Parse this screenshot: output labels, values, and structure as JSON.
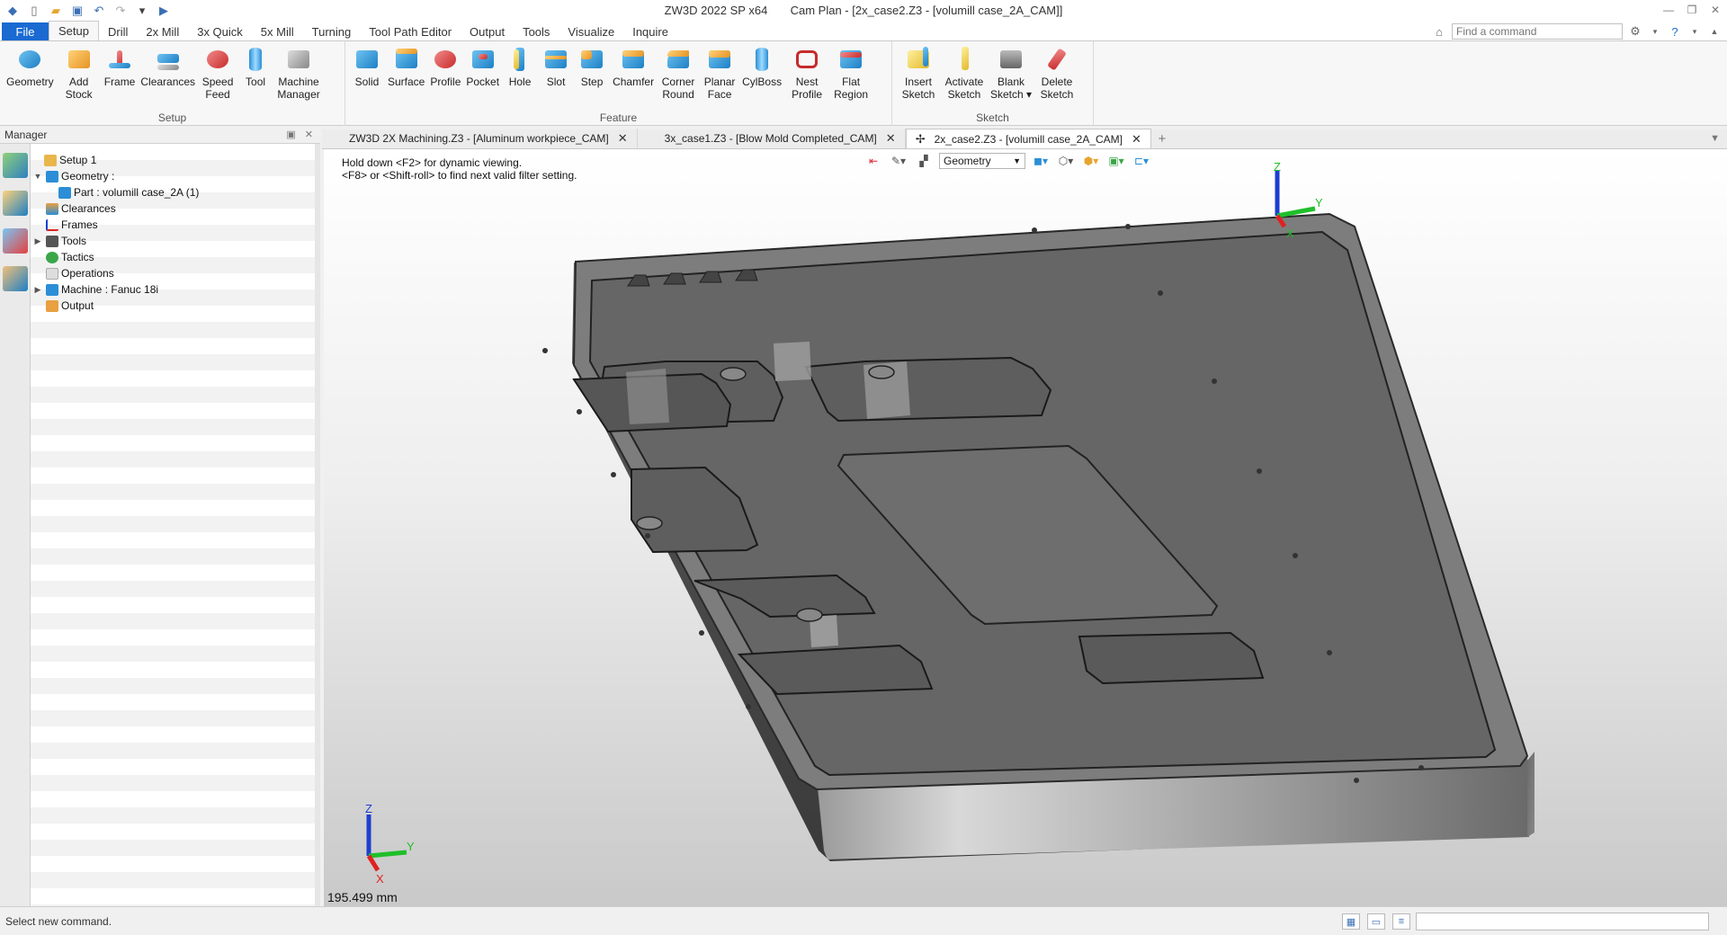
{
  "titlebar": {
    "app_title": "ZW3D 2022 SP x64",
    "doc_title": "Cam Plan - [2x_case2.Z3 - [volumill case_2A_CAM]]"
  },
  "menu": {
    "file": "File",
    "tabs": [
      "Setup",
      "Drill",
      "2x Mill",
      "3x Quick",
      "5x Mill",
      "Turning",
      "Tool Path Editor",
      "Output",
      "Tools",
      "Visualize",
      "Inquire"
    ],
    "active": "Setup",
    "command_placeholder": "Find a command"
  },
  "ribbon": {
    "setup": {
      "label": "Setup",
      "buttons": [
        {
          "label": "Geometry"
        },
        {
          "label": "Add Stock"
        },
        {
          "label": "Frame"
        },
        {
          "label": "Clearances"
        },
        {
          "label": "Speed Feed"
        },
        {
          "label": "Tool"
        },
        {
          "label": "Machine Manager"
        }
      ]
    },
    "feature": {
      "label": "Feature",
      "buttons": [
        {
          "label": "Solid"
        },
        {
          "label": "Surface"
        },
        {
          "label": "Profile"
        },
        {
          "label": "Pocket"
        },
        {
          "label": "Hole"
        },
        {
          "label": "Slot"
        },
        {
          "label": "Step"
        },
        {
          "label": "Chamfer"
        },
        {
          "label": "Corner Round"
        },
        {
          "label": "Planar Face"
        },
        {
          "label": "CylBoss"
        },
        {
          "label": "Nest Profile"
        },
        {
          "label": "Flat Region"
        }
      ]
    },
    "sketch": {
      "label": "Sketch",
      "buttons": [
        {
          "label": "Insert Sketch"
        },
        {
          "label": "Activate Sketch"
        },
        {
          "label": "Blank Sketch ▾"
        },
        {
          "label": "Delete Sketch"
        }
      ]
    }
  },
  "manager": {
    "title": "Manager",
    "tree": [
      {
        "label": "Setup 1"
      },
      {
        "label": "Geometry :"
      },
      {
        "label": "Part : volumill case_2A (1)"
      },
      {
        "label": "Clearances"
      },
      {
        "label": "Frames"
      },
      {
        "label": "Tools"
      },
      {
        "label": "Tactics"
      },
      {
        "label": "Operations"
      },
      {
        "label": "Machine : Fanuc 18i"
      },
      {
        "label": "Output"
      }
    ]
  },
  "doctabs": [
    {
      "label": "ZW3D 2X Machining.Z3 - [Aluminum workpiece_CAM]"
    },
    {
      "label": "3x_case1.Z3 - [Blow Mold Completed_CAM]"
    },
    {
      "label": "2x_case2.Z3 - [volumill case_2A_CAM]"
    }
  ],
  "viewport": {
    "hint_line1": "Hold down <F2> for dynamic viewing.",
    "hint_line2": "<F8> or <Shift-roll> to find next valid filter setting.",
    "filter_value": "Geometry",
    "scale": "195.499 mm",
    "axis": {
      "x": "X",
      "y": "Y",
      "z": "Z"
    }
  },
  "status": {
    "message": "Select new command."
  },
  "colors": {
    "file_tab": "#1a6ad2",
    "axis_x": "#e02020",
    "axis_y": "#1fbf2a",
    "axis_z": "#1c3fd0",
    "part": "#6e6e6e"
  }
}
